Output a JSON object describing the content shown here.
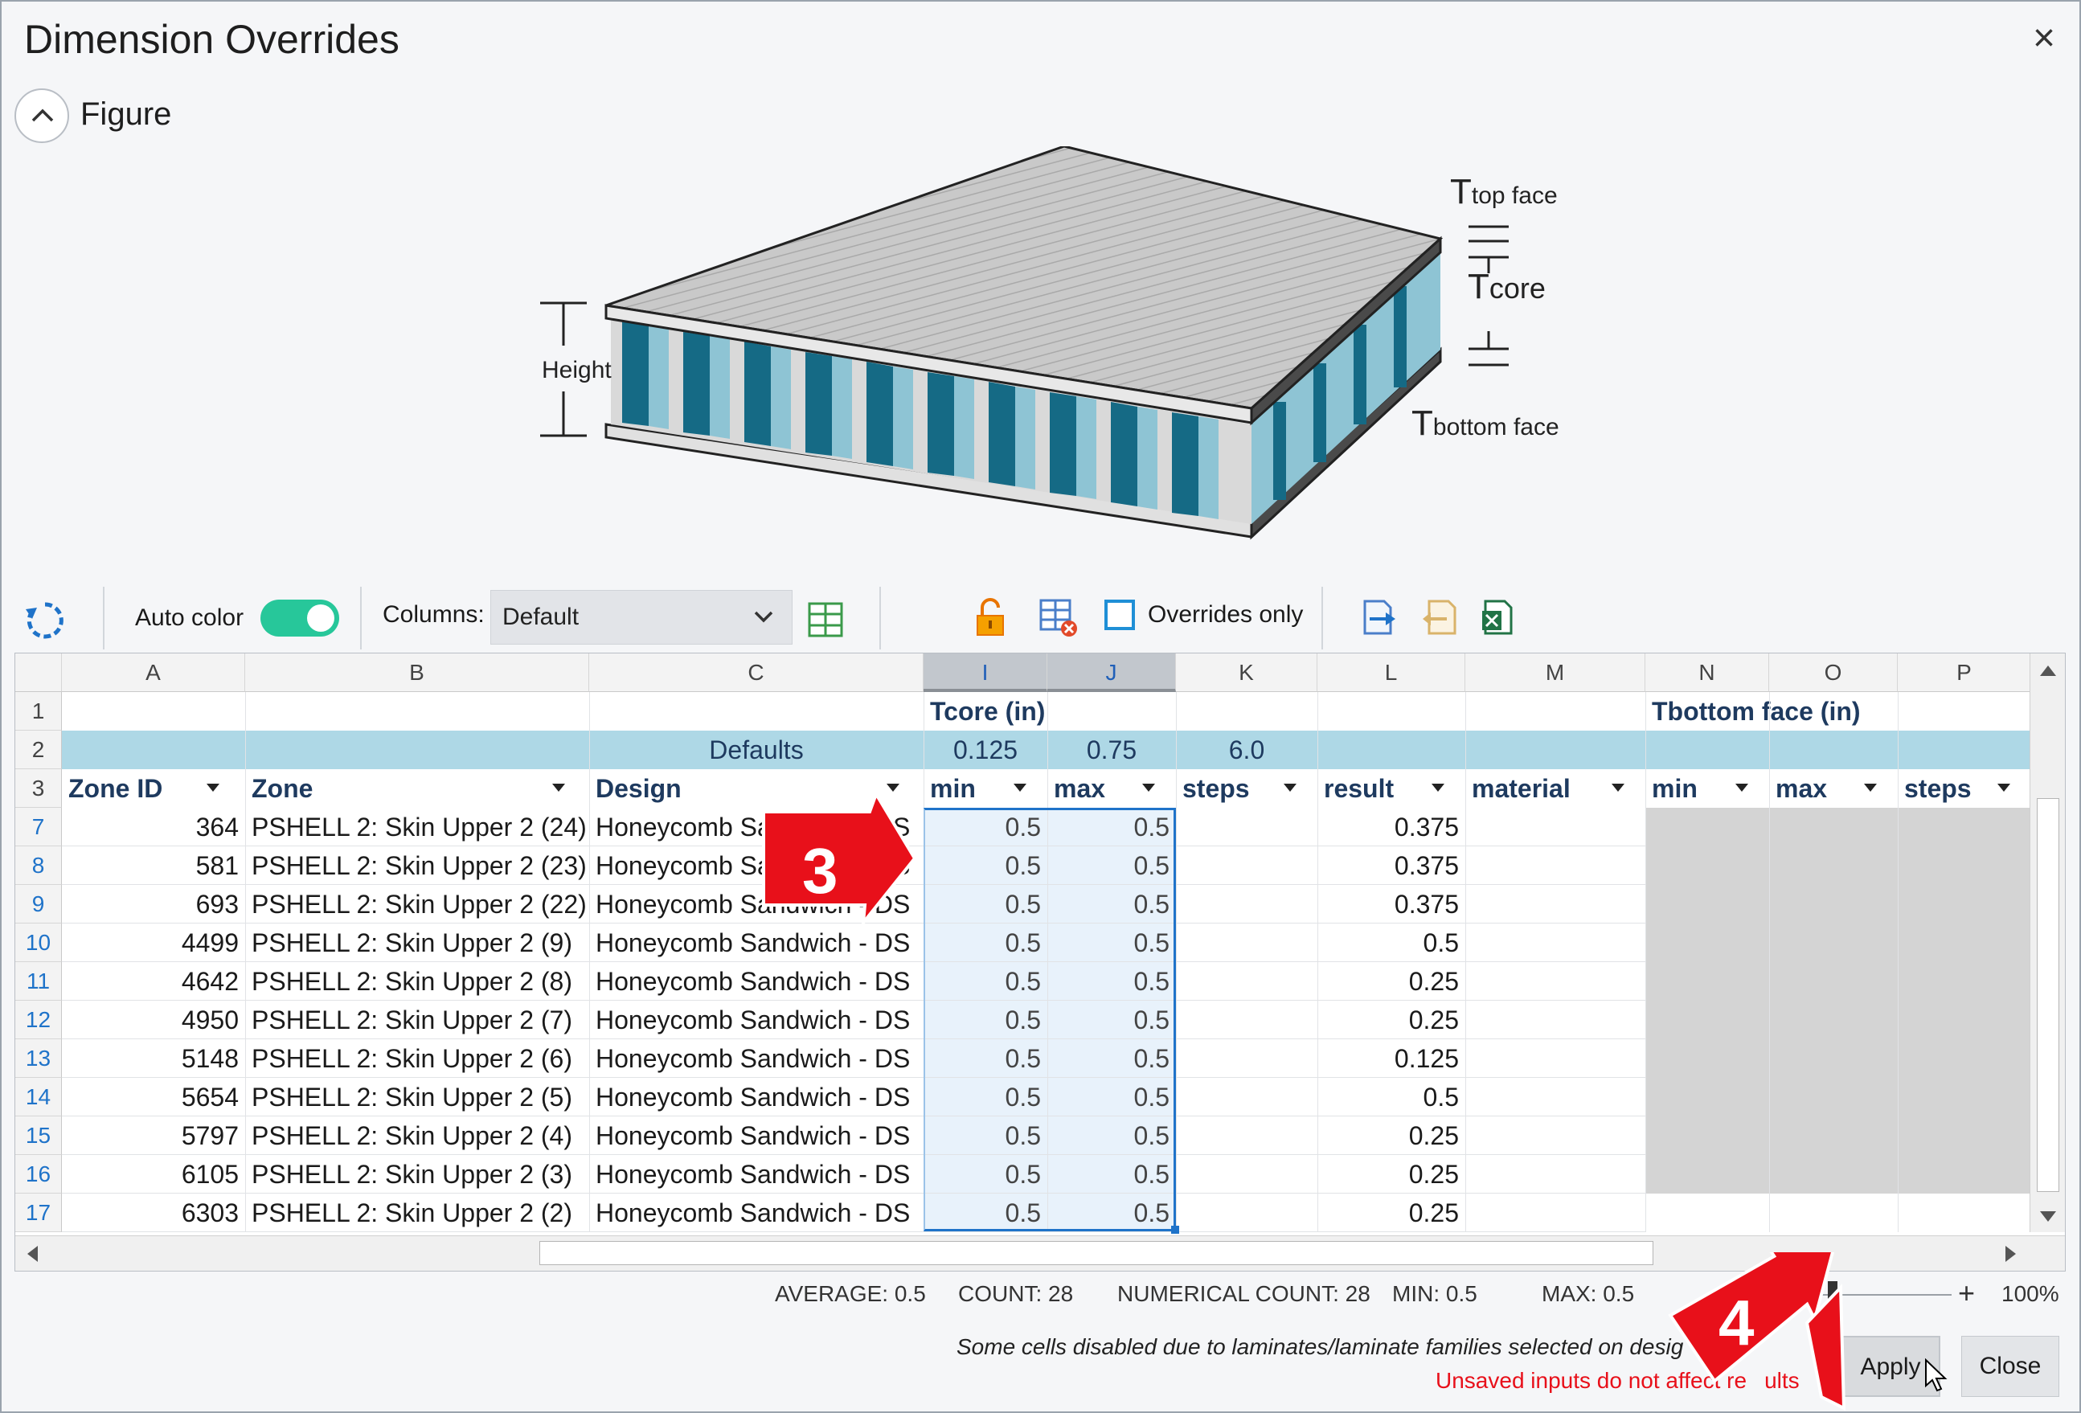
{
  "window": {
    "title": "Dimension Overrides",
    "close_glyph": "×"
  },
  "figure": {
    "toggle_label": "Figure",
    "labels": {
      "height": "Height",
      "t_top": "T",
      "t_top_sub": "top face",
      "t_core": "T",
      "t_core_sub": "core",
      "t_bottom": "T",
      "t_bottom_sub": "bottom face"
    }
  },
  "toolbar": {
    "auto_color_label": "Auto color",
    "auto_color_on": true,
    "columns_label": "Columns:",
    "columns_value": "Default",
    "overrides_only_label": "Overrides only",
    "icons": [
      "refresh-icon",
      "column-chooser-icon",
      "unlock-icon",
      "clear-table-icon",
      "export-icon",
      "import-icon",
      "excel-icon"
    ]
  },
  "grid": {
    "column_letters": [
      "A",
      "B",
      "C",
      "I",
      "J",
      "K",
      "L",
      "M",
      "N",
      "O",
      "P"
    ],
    "row1": {
      "row_number": "1",
      "group_tcore": "Tcore (in)",
      "group_tbottom": "Tbottom face (in)"
    },
    "row2": {
      "row_number": "2",
      "label": "Defaults",
      "min": "0.125",
      "max": "0.75",
      "steps": "6.0"
    },
    "row3": {
      "row_number": "3",
      "headers": [
        "Zone ID",
        "Zone",
        "Design",
        "min",
        "max",
        "steps",
        "result",
        "material",
        "min",
        "max",
        "steps"
      ]
    },
    "rows": [
      {
        "row": "7",
        "zone_id": "364",
        "zone": "PSHELL 2: Skin Upper 2 (24)",
        "design": "Honeycomb Sandwich - DS",
        "min": "0.5",
        "max": "0.5",
        "result": "0.375"
      },
      {
        "row": "8",
        "zone_id": "581",
        "zone": "PSHELL 2: Skin Upper 2 (23)",
        "design": "Honeycomb Sandwich - DS",
        "min": "0.5",
        "max": "0.5",
        "result": "0.375"
      },
      {
        "row": "9",
        "zone_id": "693",
        "zone": "PSHELL 2: Skin Upper 2 (22)",
        "design": "Honeycomb Sandwich - DS",
        "min": "0.5",
        "max": "0.5",
        "result": "0.375"
      },
      {
        "row": "10",
        "zone_id": "4499",
        "zone": "PSHELL 2: Skin Upper 2 (9)",
        "design": "Honeycomb Sandwich - DS",
        "min": "0.5",
        "max": "0.5",
        "result": "0.5"
      },
      {
        "row": "11",
        "zone_id": "4642",
        "zone": "PSHELL 2: Skin Upper 2 (8)",
        "design": "Honeycomb Sandwich - DS",
        "min": "0.5",
        "max": "0.5",
        "result": "0.25"
      },
      {
        "row": "12",
        "zone_id": "4950",
        "zone": "PSHELL 2: Skin Upper 2 (7)",
        "design": "Honeycomb Sandwich - DS",
        "min": "0.5",
        "max": "0.5",
        "result": "0.25"
      },
      {
        "row": "13",
        "zone_id": "5148",
        "zone": "PSHELL 2: Skin Upper 2 (6)",
        "design": "Honeycomb Sandwich - DS",
        "min": "0.5",
        "max": "0.5",
        "result": "0.125"
      },
      {
        "row": "14",
        "zone_id": "5654",
        "zone": "PSHELL 2: Skin Upper 2 (5)",
        "design": "Honeycomb Sandwich - DS",
        "min": "0.5",
        "max": "0.5",
        "result": "0.5"
      },
      {
        "row": "15",
        "zone_id": "5797",
        "zone": "PSHELL 2: Skin Upper 2 (4)",
        "design": "Honeycomb Sandwich - DS",
        "min": "0.5",
        "max": "0.5",
        "result": "0.25"
      },
      {
        "row": "16",
        "zone_id": "6105",
        "zone": "PSHELL 2: Skin Upper 2 (3)",
        "design": "Honeycomb Sandwich - DS",
        "min": "0.5",
        "max": "0.5",
        "result": "0.25"
      },
      {
        "row": "17",
        "zone_id": "6303",
        "zone": "PSHELL 2: Skin Upper 2 (2)",
        "design": "Honeycomb Sandwich - DS",
        "min": "0.5",
        "max": "0.5",
        "result": "0.25"
      }
    ]
  },
  "statusbar": {
    "average": "AVERAGE: 0.5",
    "count": "COUNT: 28",
    "numerical_count": "NUMERICAL COUNT: 28",
    "min": "MIN: 0.5",
    "max": "MAX: 0.5",
    "zoom": "100%",
    "zoom_level": 0.1
  },
  "footer": {
    "disabled_note": "Some cells disabled due to laminates/laminate families selected on desig",
    "unsaved_note": "Unsaved inputs do not affect re",
    "unsaved_note_tail": "ults",
    "apply_label": "Apply",
    "close_label": "Close"
  },
  "callouts": {
    "step3": "3",
    "step4": "4"
  },
  "colors": {
    "accent_blue": "#1f73c9",
    "toggle_green": "#27c79a",
    "defaults_row": "#aed8e6",
    "selection_fill": "#e8f2fb",
    "disabled_fill": "#d4d4d4",
    "callout_red": "#e8101a",
    "warning_red": "#e8101a",
    "core_teal": "#156a85"
  }
}
